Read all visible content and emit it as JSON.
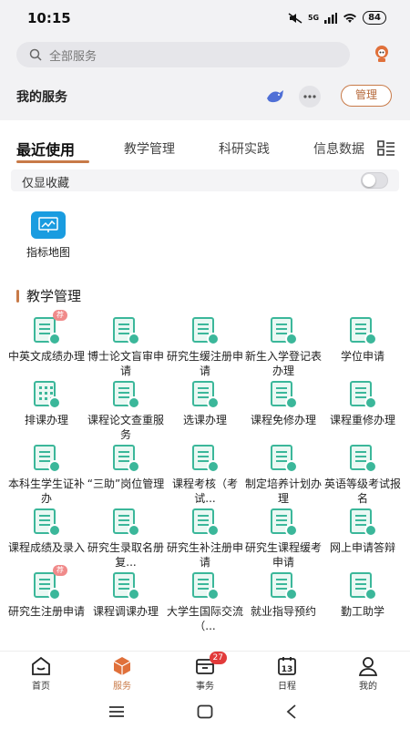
{
  "status": {
    "time": "10:15",
    "network": "5G",
    "battery": "84"
  },
  "search": {
    "placeholder": "全部服务"
  },
  "services": {
    "title": "我的服务",
    "manage_label": "管理"
  },
  "tabs": [
    {
      "label": "最近使用",
      "active": true
    },
    {
      "label": "教学管理",
      "active": false
    },
    {
      "label": "科研实践",
      "active": false
    },
    {
      "label": "信息数据",
      "active": false
    }
  ],
  "favorites": {
    "label": "仅显收藏",
    "enabled": false
  },
  "recent": [
    {
      "label": "指标地图"
    }
  ],
  "section": {
    "title": "教学管理"
  },
  "grid_items": [
    {
      "label": "中英文成绩办理",
      "badge": "荐"
    },
    {
      "label": "博士论文盲审申请"
    },
    {
      "label": "研究生缓注册申请"
    },
    {
      "label": "新生入学登记表办理"
    },
    {
      "label": "学位申请"
    },
    {
      "label": "排课办理"
    },
    {
      "label": "课程论文查重服务"
    },
    {
      "label": "选课办理"
    },
    {
      "label": "课程免修办理"
    },
    {
      "label": "课程重修办理"
    },
    {
      "label": "本科生学生证补办"
    },
    {
      "label": "“三助”岗位管理"
    },
    {
      "label": "课程考核（考试..."
    },
    {
      "label": "制定培养计划办理"
    },
    {
      "label": "英语等级考试报名"
    },
    {
      "label": "课程成绩及录入"
    },
    {
      "label": "研究生录取名册复..."
    },
    {
      "label": "研究生补注册申请"
    },
    {
      "label": "研究生课程缓考申请"
    },
    {
      "label": "网上申请答辩"
    },
    {
      "label": "研究生注册申请",
      "badge": "荐"
    },
    {
      "label": "课程调课办理"
    },
    {
      "label": "大学生国际交流（..."
    },
    {
      "label": "就业指导预约"
    },
    {
      "label": "勤工助学"
    }
  ],
  "bottom_nav": [
    {
      "label": "首页",
      "active": false
    },
    {
      "label": "服务",
      "active": true
    },
    {
      "label": "事务",
      "active": false,
      "badge": "27"
    },
    {
      "label": "日程",
      "active": false,
      "icon_text": "13"
    },
    {
      "label": "我的",
      "active": false
    }
  ],
  "colors": {
    "accent": "#c87a48",
    "icon_green": "#3bb79a",
    "map_blue": "#1a9ce0",
    "badge_red": "#e23b3b"
  }
}
